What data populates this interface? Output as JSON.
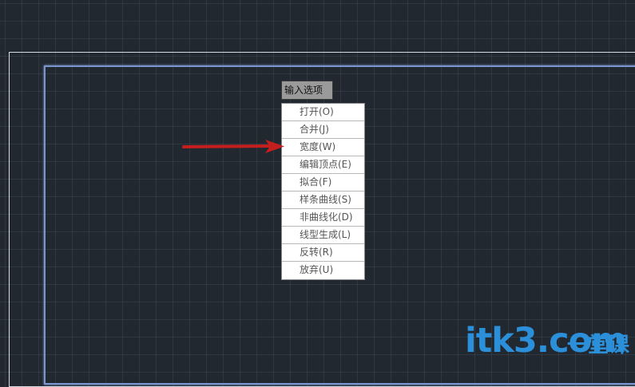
{
  "prompt": {
    "label": "输入选项"
  },
  "menu": {
    "items": [
      {
        "label": "打开(O)"
      },
      {
        "label": "合并(J)"
      },
      {
        "label": "宽度(W)"
      },
      {
        "label": "编辑顶点(E)"
      },
      {
        "label": "拟合(F)"
      },
      {
        "label": "样条曲线(S)"
      },
      {
        "label": "非曲线化(D)"
      },
      {
        "label": "线型生成(L)"
      },
      {
        "label": "反转(R)"
      },
      {
        "label": "放弃(U)"
      }
    ]
  },
  "annotation": {
    "arrow_icon": "arrow-right-icon",
    "arrow_color": "#c41e1e",
    "points_to": "宽度(W)"
  },
  "watermark": {
    "main_text": "itk3.com",
    "cn_text": "一堂课",
    "color": "#2b8fd9"
  },
  "colors": {
    "background": "#212830",
    "viewport_border": "#7a95cf",
    "frame_border": "#d6dbe2"
  }
}
